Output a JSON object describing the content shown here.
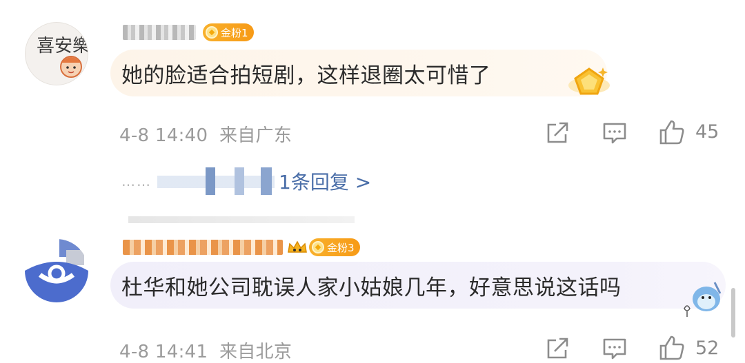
{
  "comments": [
    {
      "badge": "金粉1",
      "text": "她的脸适合拍短剧，这样退圈太可惜了",
      "date": "4-8 14:40",
      "location": "来自广东",
      "likes": "45",
      "avatar_text": "喜安樂"
    },
    {
      "badge": "金粉3",
      "text": "杜华和她公司耽误人家小姑娘几年，好意思说这话吗",
      "date": "4-8 14:41",
      "location": "来自北京",
      "likes": "52"
    }
  ],
  "reply_link": "1条回复 >",
  "reply_prefix": "……",
  "icons": {
    "share": "share-icon",
    "comment": "comment-icon",
    "like": "thumbs-up-icon"
  },
  "colors": {
    "badge": "#f8a21f",
    "reply_link": "#4a6ea8",
    "meta_text": "#9b9b9b"
  }
}
